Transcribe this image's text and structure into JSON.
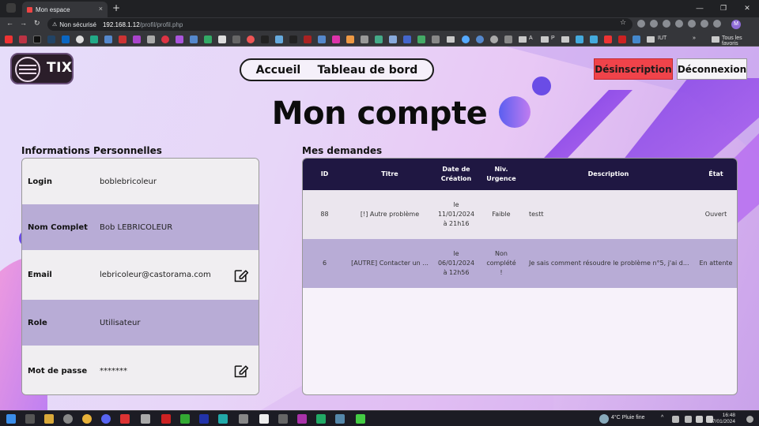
{
  "browser": {
    "tab_title": "Mon espace",
    "tab_close": "×",
    "new_tab": "+",
    "window_controls": [
      "—",
      "❐",
      "✕"
    ],
    "nav": {
      "back": "←",
      "forward": "→",
      "reload": "↻"
    },
    "security_label": "Non sécurisé",
    "url_host": "192.168.1.12",
    "url_path": "/profil/profil.php",
    "profile_initial": "M",
    "bookmark_labels": {
      "a": "A",
      "p": "P",
      "iut": "IUT",
      "all": "Tous les favoris"
    }
  },
  "header": {
    "logo_text": "TIX",
    "nav": {
      "home": "Accueil",
      "dashboard": "Tableau de bord"
    },
    "unsubscribe": "Désinscription",
    "logout": "Déconnexion"
  },
  "page_title": "Mon compte",
  "personal_info": {
    "heading": "Informations Personnelles",
    "rows": [
      {
        "label": "Login",
        "value": "boblebricoleur",
        "editable": false
      },
      {
        "label": "Nom Complet",
        "value": "Bob LEBRICOLEUR",
        "editable": false
      },
      {
        "label": "Email",
        "value": "lebricoleur@castorama.com",
        "editable": true
      },
      {
        "label": "Role",
        "value": "Utilisateur",
        "editable": false
      },
      {
        "label": "Mot de passe",
        "value": "*******",
        "editable": true
      }
    ]
  },
  "requests": {
    "heading": "Mes demandes",
    "columns": {
      "id": "ID",
      "title": "Titre",
      "created_1": "Date de",
      "created_2": "Création",
      "urgency_1": "Niv.",
      "urgency_2": "Urgence",
      "description": "Description",
      "status": "État"
    },
    "rows": [
      {
        "id": "88",
        "title": "[!] Autre problème",
        "date_1": "le",
        "date_2": "11/01/2024",
        "date_3": "à 21h16",
        "urgency_1": "Faible",
        "urgency_2": "",
        "urgency_3": "",
        "description": "testt",
        "status": "Ouvert"
      },
      {
        "id": "6",
        "title": "[AUTRE] Contacter un ...",
        "date_1": "le",
        "date_2": "06/01/2024",
        "date_3": "à 12h56",
        "urgency_1": "Non",
        "urgency_2": "complété",
        "urgency_3": "!",
        "description": "Je sais comment résoudre le problème n°5, j'ai d...",
        "status": "En attente"
      }
    ]
  },
  "taskbar": {
    "weather": "4°C  Pluie fine",
    "time": "16:48",
    "date": "17/01/2024"
  },
  "colors": {
    "accent_dark": "#1f1742",
    "row_alt": "#b8acd6",
    "danger": "#f0434a"
  }
}
